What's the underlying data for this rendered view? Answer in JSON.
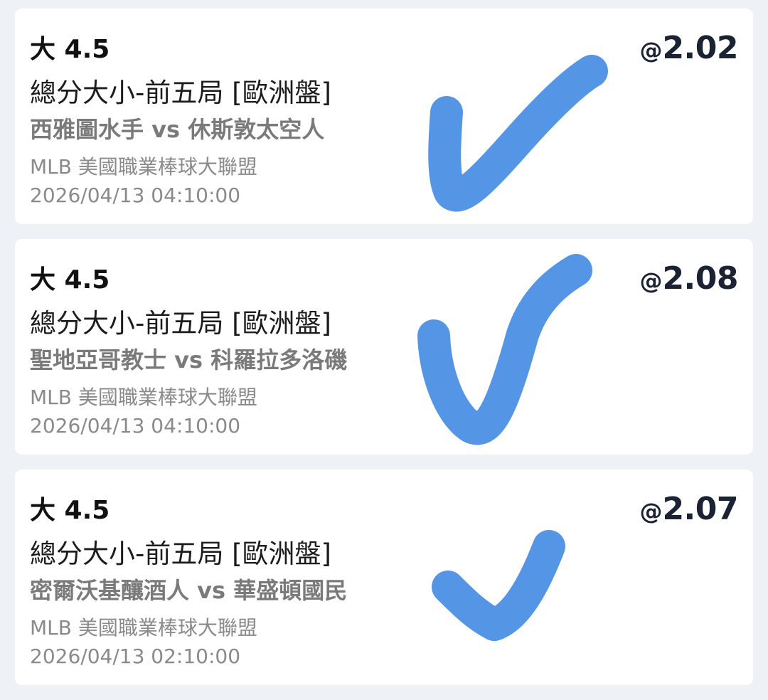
{
  "bets": [
    {
      "selection": "大 4.5",
      "market": "總分大小-前五局 [歐洲盤]",
      "matchup": "西雅圖水手 vs 休斯敦太空人",
      "league": "MLB 美國職業棒球大聯盟",
      "datetime": "2026/04/13 04:10:00",
      "odds_prefix": "@",
      "odds": "2.02"
    },
    {
      "selection": "大 4.5",
      "market": "總分大小-前五局 [歐洲盤]",
      "matchup": "聖地亞哥教士 vs 科羅拉多洛磯",
      "league": "MLB 美國職業棒球大聯盟",
      "datetime": "2026/04/13 04:10:00",
      "odds_prefix": "@",
      "odds": "2.08"
    },
    {
      "selection": "大 4.5",
      "market": "總分大小-前五局 [歐洲盤]",
      "matchup": "密爾沃基釀酒人 vs 華盛頓國民",
      "league": "MLB 美國職業棒球大聯盟",
      "datetime": "2026/04/13 02:10:00",
      "odds_prefix": "@",
      "odds": "2.07"
    }
  ],
  "annotation": {
    "icon": "checkmark-icon",
    "color": "#5595e6"
  }
}
